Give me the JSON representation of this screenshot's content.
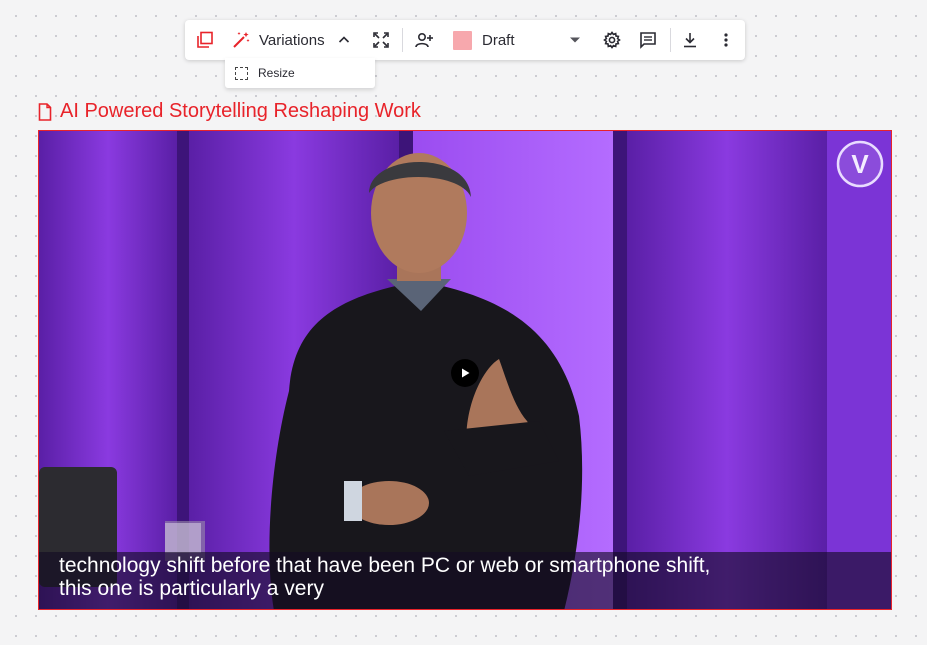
{
  "toolbar": {
    "variations_label": "Variations",
    "status_label": "Draft",
    "status_color": "#f7a8ad"
  },
  "variations_menu": {
    "items": [
      {
        "label": "Resize",
        "icon": "resize-icon"
      }
    ]
  },
  "document": {
    "title": "AI Powered Storytelling Reshaping Work"
  },
  "video": {
    "caption_line1": "technology shift before that have been PC or web or smartphone shift,",
    "caption_line2": "this one is particularly a very",
    "logo_letter": "V"
  },
  "colors": {
    "accent": "#e8232a",
    "stage_purple": "#7a2fd0"
  }
}
